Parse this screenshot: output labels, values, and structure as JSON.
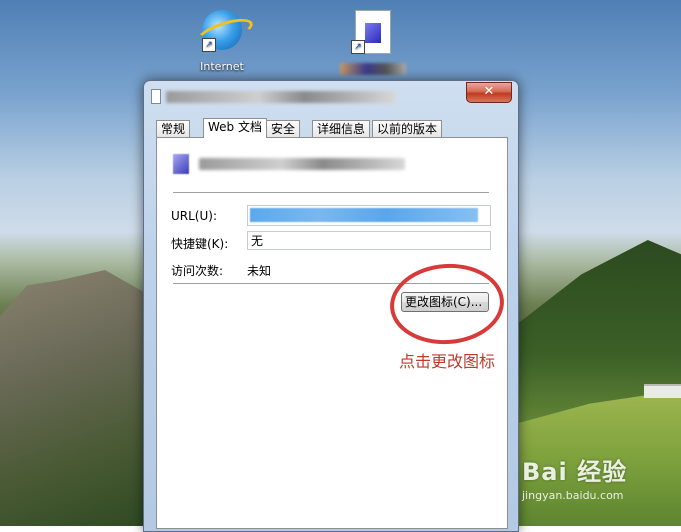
{
  "desktop": {
    "icons": [
      {
        "label": "Internet",
        "icon": "internet-explorer-icon"
      },
      {
        "label": "",
        "icon": "document-shortcut-icon"
      }
    ]
  },
  "dialog": {
    "title": "",
    "close_symbol": "✕",
    "tabs": [
      {
        "label": "常规",
        "active": false
      },
      {
        "label": "Web 文档",
        "active": true
      },
      {
        "label": "安全",
        "active": false
      },
      {
        "label": "详细信息",
        "active": false
      },
      {
        "label": "以前的版本",
        "active": false
      }
    ],
    "fields": {
      "url_label": "URL(U):",
      "url_value": "",
      "shortcut_label": "快捷键(K):",
      "shortcut_value": "无",
      "visits_label": "访问次数:",
      "visits_value": "未知"
    },
    "change_icon_button": "更改图标(C)..."
  },
  "annotation": {
    "text": "点击更改图标",
    "color": "#d83a3a"
  },
  "watermark": {
    "brand": "Bai 经验",
    "url": "jingyan.baidu.com"
  }
}
